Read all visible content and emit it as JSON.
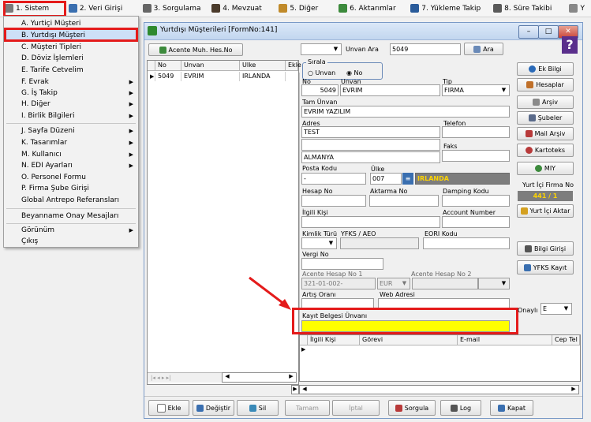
{
  "menubar": {
    "items": [
      {
        "label": "1.  Sistem",
        "icon": "wrench-icon"
      },
      {
        "label": "2.  Veri Girişi",
        "icon": "edit-icon"
      },
      {
        "label": "3.  Sorgulama",
        "icon": "report-icon"
      },
      {
        "label": "4.  Mevzuat",
        "icon": "books-icon"
      },
      {
        "label": "5.  Diğer",
        "icon": "tools-icon"
      },
      {
        "label": "6.  Aktarımlar",
        "icon": "transfer-icon"
      },
      {
        "label": "7.  Yükleme Takip",
        "icon": "truck-icon"
      },
      {
        "label": "8. Süre Takibi",
        "icon": "calendar-icon"
      },
      {
        "label": "Y",
        "icon": "more-icon"
      }
    ]
  },
  "dropdown": {
    "items": [
      {
        "label": "A.  Yurtiçi Müşteri",
        "submenu": false
      },
      {
        "label": "B.  Yurtdışı Müşteri",
        "submenu": false
      },
      {
        "label": "C.  Müşteri Tipleri",
        "submenu": false
      },
      {
        "label": "D.  Döviz İşlemleri",
        "submenu": false
      },
      {
        "label": "E.  Tarife Cetvelim",
        "submenu": false
      },
      {
        "label": "F.  Evrak",
        "submenu": true
      },
      {
        "label": "G.  İş Takip",
        "submenu": true
      },
      {
        "label": "H.  Diğer",
        "submenu": true
      },
      {
        "label": "I.  Birlik Bilgileri",
        "submenu": true
      },
      {
        "label": "J.  Sayfa Düzeni",
        "submenu": true
      },
      {
        "label": "K.  Tasarımlar",
        "submenu": true
      },
      {
        "label": "M.  Kullanıcı",
        "submenu": true
      },
      {
        "label": "N.  EDI Ayarları",
        "submenu": true
      },
      {
        "label": "O.  Personel Formu",
        "submenu": false
      },
      {
        "label": "P.  Firma Şube Girişi",
        "submenu": false
      },
      {
        "label": "Global Antrepo Referansları",
        "submenu": false
      },
      {
        "label": "Beyanname Onay Mesajları",
        "submenu": false
      },
      {
        "label": "Görünüm",
        "submenu": true
      },
      {
        "label": "Çıkış",
        "submenu": false
      }
    ]
  },
  "window": {
    "title": "Yurtdışı Müşterileri [FormNo:141]",
    "acente_button": "Acente Muh. Hes.No",
    "search_label": "Unvan Ara",
    "search_value": "5049",
    "ara_button": "Ara",
    "sirala_label": "Sırala",
    "radio_unvan": "Unvan",
    "radio_no": "No",
    "grid": {
      "headers": [
        "No",
        "Unvan",
        "Ulke",
        "Ekle"
      ],
      "rows": [
        [
          "5049",
          "EVRIM",
          "IRLANDA",
          ""
        ]
      ]
    },
    "form": {
      "no_label": "No",
      "no_value": "5049",
      "unvan_label": "Unvan",
      "unvan_value": "EVRIM",
      "tip_label": "Tip",
      "tip_value": "FIRMA",
      "tam_unvan_label": "Tam Ünvan",
      "tam_unvan_value": "EVRIM YAZILIM",
      "adres_label": "Adres",
      "adres_line1": "TEST",
      "adres_line3": "ALMANYA",
      "telefon_label": "Telefon",
      "faks_label": "Faks",
      "posta_kodu_label": "Posta Kodu",
      "posta_kodu_value": "-",
      "ulke_label": "Ülke",
      "ulke_code": "007",
      "ulke_name": "IRLANDA",
      "hesap_no_label": "Hesap No",
      "aktarma_no_label": "Aktarma No",
      "damping_label": "Damping Kodu",
      "ilgili_kisi_label": "İlgili Kişi",
      "account_number_label": "Account Number",
      "kimlik_turu_label": "Kimlik Türü",
      "yfks_aeo_label": "YFKS / AEO",
      "eori_label": "EORI Kodu",
      "vergi_no_label": "Vergi No",
      "acente_hesap1_label": "Acente Hesap No 1",
      "acente_hesap1_value": "321-01-002-",
      "acente_currency": "EUR",
      "acente_hesap2_label": "Acente Hesap No 2",
      "artis_orani_label": "Artış Oranı",
      "web_adresi_label": "Web Adresi",
      "kayit_belgesi_label": "Kayıt Belgesi Ünvanı",
      "kayit_belgesi_value": "",
      "onayli_label": "Onaylı",
      "onayli_value": "E"
    },
    "contacts_headers": [
      "İlgili Kişi",
      "Görevi",
      "E-mail",
      "Cep Tel"
    ],
    "side_buttons": {
      "ek_bilgi": "Ek Bilgi",
      "hesaplar": "Hesaplar",
      "arsiv": "Arşiv",
      "subeler": "Şubeler",
      "mail_arsiv": "Mail Arşiv",
      "kartoteks": "Kartoteks",
      "miy": "MIY",
      "yurtici_firma_no_label": "Yurt İçi Firma No",
      "yurtici_firma_no_value": "441 / 1",
      "yurtici_aktar": "Yurt İçi Aktar",
      "bilgi_girisi": "Bilgi Girişi",
      "yfks_kayit": "YFKS Kayıt"
    },
    "bottom_buttons": {
      "ekle": "Ekle",
      "degistir": "Değiştir",
      "sil": "Sil",
      "tamam": "Tamam",
      "iptal": "İptal",
      "sorgula": "Sorgula",
      "log": "Log",
      "kapat": "Kapat"
    }
  }
}
